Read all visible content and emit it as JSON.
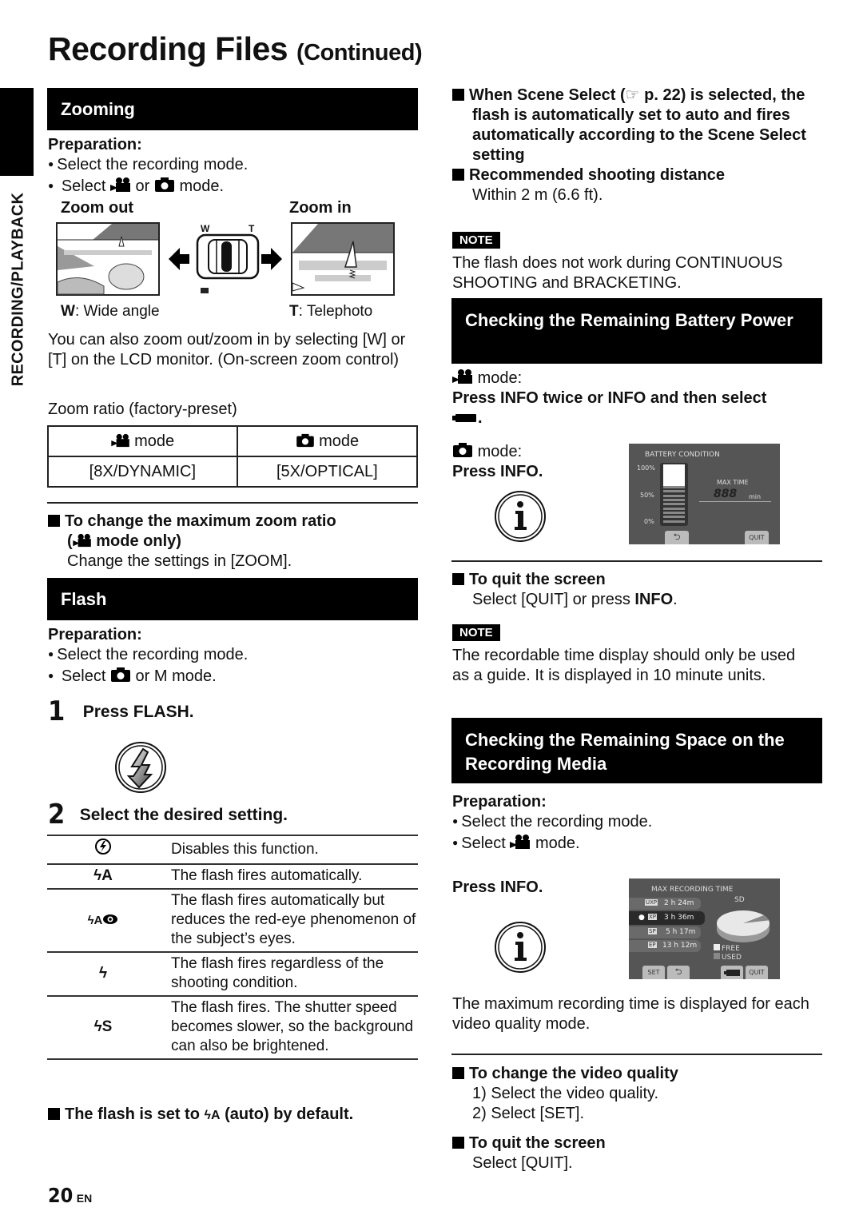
{
  "page": {
    "title": "Recording Files",
    "title_suffix": "(Continued)",
    "side_tab": "RECORDING/PLAYBACK",
    "page_number": "20",
    "page_lang": "EN"
  },
  "zooming": {
    "heading": "Zooming",
    "prep_label": "Preparation:",
    "prep_items": [
      "Select the recording mode.",
      "Select",
      "or",
      "mode."
    ],
    "zoom_out_label": "Zoom out",
    "zoom_in_label": "Zoom in",
    "lever_w": "W",
    "lever_t": "T",
    "w_key": "W",
    "w_desc": ": Wide angle",
    "t_key": "T",
    "t_desc": ": Telephoto",
    "paragraph": "You can also zoom out/zoom in by selecting [W] or [T] on the LCD monitor. (On-screen zoom control)",
    "ratio_caption": "Zoom ratio (factory-preset)",
    "ratio_table": {
      "headers": [
        "mode",
        "mode"
      ],
      "values": [
        "[8X/DYNAMIC]",
        "[5X/OPTICAL]"
      ]
    },
    "max_zoom_heading": "To change the maximum zoom ratio",
    "max_zoom_sub": "mode only)",
    "max_zoom_text": "Change the settings in [ZOOM]."
  },
  "flash": {
    "heading": "Flash",
    "prep_label": "Preparation:",
    "prep_items": [
      "Select the recording mode.",
      "Select",
      "or M mode."
    ],
    "step1_num": "1",
    "step1_text": "Press FLASH.",
    "step2_num": "2",
    "step2_text": "Select the desired setting.",
    "settings": [
      {
        "icon": "flash-off",
        "desc": "Disables this function."
      },
      {
        "icon": "flash-auto",
        "desc": "The flash fires automatically."
      },
      {
        "icon": "flash-auto-redeye",
        "desc": "The flash fires automatically but reduces the red-eye phenomenon of the subject’s eyes."
      },
      {
        "icon": "flash-on",
        "desc": "The flash fires regardless of the shooting condition."
      },
      {
        "icon": "flash-slow-sync",
        "desc": "The flash fires. The shutter speed becomes slower, so the background can also be brightened."
      }
    ],
    "default_pre": "The flash is set to",
    "default_post": "(auto) by default."
  },
  "right": {
    "scene_note": "When Scene Select (",
    "scene_ref": "p. 22) is selected, the flash is automatically set to auto and fires automatically according to the Scene Select setting",
    "distance_heading": "Recommended shooting distance",
    "distance_text": "Within 2 m (6.6 ft).",
    "note_label": "NOTE",
    "note1": "The flash does not work during CONTINUOUS SHOOTING and BRACKETING.",
    "battery": {
      "heading": "Checking the Remaining Battery Power",
      "video_mode": "mode:",
      "video_instr": "Press INFO twice or INFO and then select",
      "photo_mode": "mode:",
      "photo_instr": "Press INFO.",
      "screen": {
        "title": "BATTERY CONDITION",
        "levels": [
          "100%",
          "50%",
          "0%"
        ],
        "max_time_label": "MAX TIME",
        "max_time_value": "888",
        "max_time_unit": "min",
        "charge_fraction": 0.33,
        "back_btn": "back",
        "quit_btn": "QUIT"
      },
      "quit_heading": "To quit the screen",
      "quit_text_pre": "Select [QUIT] or press ",
      "quit_text_bold": "INFO",
      "quit_text_post": ".",
      "note_label": "NOTE",
      "note2": "The recordable time display should only be used as a guide. It is displayed in 10 minute units."
    },
    "space": {
      "heading": "Checking the Remaining Space on the Recording Media",
      "prep_label": "Preparation:",
      "prep_items": [
        "Select the recording mode.",
        "Select",
        "mode."
      ],
      "instr": "Press INFO.",
      "screen": {
        "title": "MAX RECORDING TIME",
        "media": "SD",
        "rows": [
          {
            "mode": "UXP",
            "time": "2 h 24m",
            "selected": false
          },
          {
            "mode": "XP",
            "time": "3 h 36m",
            "selected": true
          },
          {
            "mode": "SP",
            "time": "5 h 17m",
            "selected": false
          },
          {
            "mode": "EP",
            "time": "13 h 12m",
            "selected": false
          }
        ],
        "used_fraction": 0.07,
        "legend_free": "FREE",
        "legend_used": "USED",
        "buttons": [
          "SET",
          "back",
          "battery",
          "QUIT"
        ]
      },
      "para": "The maximum recording time is displayed for each video quality mode.",
      "vq_heading": "To change the video quality",
      "vq_steps": [
        "1) Select the video quality.",
        "2) Select [SET]."
      ],
      "quit_heading": "To quit the screen",
      "quit_text": "Select [QUIT]."
    }
  }
}
